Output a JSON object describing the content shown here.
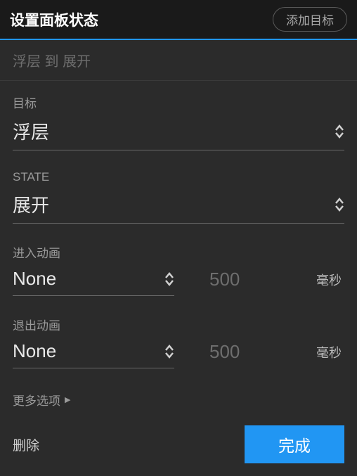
{
  "header": {
    "title": "设置面板状态",
    "add_target": "添加目标"
  },
  "breadcrumb": "浮层 到 展开",
  "fields": {
    "target_label": "目标",
    "target_value": "浮层",
    "state_label": "STATE",
    "state_value": "展开",
    "enter_anim_label": "进入动画",
    "enter_anim_value": "None",
    "enter_duration": "500",
    "exit_anim_label": "退出动画",
    "exit_anim_value": "None",
    "exit_duration": "500",
    "unit": "毫秒"
  },
  "more_options": "更多选项",
  "footer": {
    "delete": "删除",
    "done": "完成"
  }
}
